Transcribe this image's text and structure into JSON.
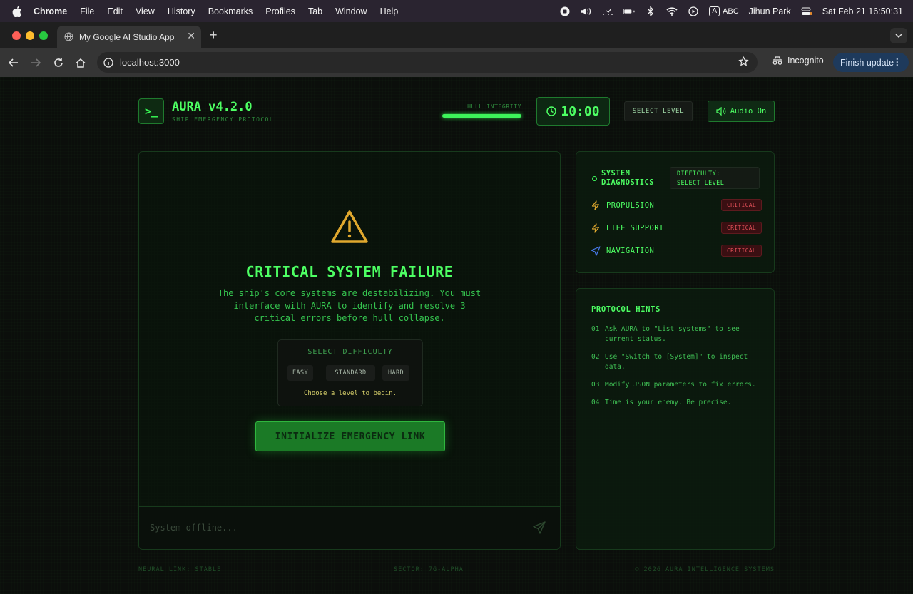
{
  "menubar": {
    "app": "Chrome",
    "items": [
      "File",
      "Edit",
      "View",
      "History",
      "Bookmarks",
      "Profiles",
      "Tab",
      "Window",
      "Help"
    ],
    "input_source": "ABC",
    "user": "Jihun Park",
    "datetime": "Sat Feb 21  16:50:31"
  },
  "browser": {
    "tab_title": "My Google AI Studio App",
    "url": "localhost:3000",
    "profile_label": "Incognito",
    "update_label": "Finish update"
  },
  "header": {
    "title": "AURA v4.2.0",
    "subtitle": "SHIP EMERGENCY PROTOCOL",
    "hull_label": "HULL INTEGRITY",
    "hull_integrity": 1.0,
    "timer": "10:00",
    "select_level": "SELECT LEVEL",
    "audio": "Audio On"
  },
  "main": {
    "title": "CRITICAL SYSTEM FAILURE",
    "description": "The ship's core systems are destabilizing. You must interface with AURA to identify and resolve 3 critical errors before hull collapse.",
    "difficulty_title": "SELECT DIFFICULTY",
    "difficulty_options": [
      "EASY",
      "STANDARD",
      "HARD"
    ],
    "difficulty_hint": "Choose a level to begin.",
    "init_button": "INITIALIZE EMERGENCY LINK",
    "input_placeholder": "System offline..."
  },
  "diagnostics": {
    "title_line1": "SYSTEM",
    "title_line2": "DIAGNOSTICS",
    "badge_line1": "DIFFICULTY:",
    "badge_line2": "SELECT LEVEL",
    "systems": [
      {
        "name": "PROPULSION",
        "status": "CRITICAL",
        "icon": "bolt-icon"
      },
      {
        "name": "LIFE SUPPORT",
        "status": "CRITICAL",
        "icon": "bolt-icon"
      },
      {
        "name": "NAVIGATION",
        "status": "CRITICAL",
        "icon": "navigation-arrow-icon"
      }
    ]
  },
  "hints": {
    "title": "PROTOCOL HINTS",
    "items": [
      {
        "num": "01",
        "text": "Ask AURA to \"List systems\" to see current status."
      },
      {
        "num": "02",
        "text": "Use \"Switch to [System]\" to inspect data."
      },
      {
        "num": "03",
        "text": "Modify JSON parameters to fix errors."
      },
      {
        "num": "04",
        "text": "Time is your enemy. Be precise."
      }
    ]
  },
  "footer": {
    "left": "NEURAL LINK: STABLE",
    "center": "SECTOR: 7G-ALPHA",
    "right": "© 2026 AURA INTELLIGENCE SYSTEMS"
  },
  "colors": {
    "accent": "#4dff63",
    "critical": "#e05058",
    "warning": "#e0a82e",
    "background": "#0b0e0b"
  }
}
